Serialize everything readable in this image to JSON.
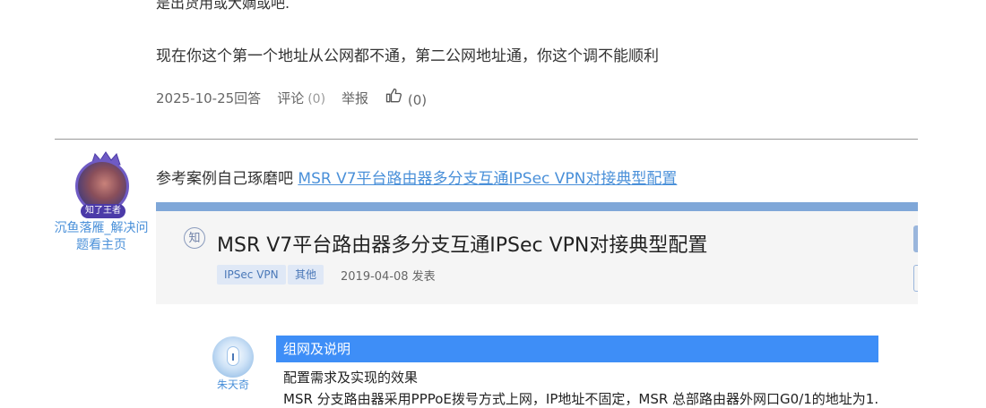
{
  "answer_prev": {
    "cut_text": "是出货用或大嫡或吧.",
    "text": "现在你这个第一个地址从公网都不通，第二公网地址通，你这个调不能顺利",
    "date_label": "2025-10-25回答",
    "comment_label": "评论",
    "comment_count": "(0)",
    "report_label": "举报",
    "like_count": "(0)"
  },
  "answer": {
    "author": {
      "badge": "知了王者",
      "name_link": "沉鱼落雁_解决问题看主页"
    },
    "ref_prefix": "参考案例自己琢磨吧 ",
    "ref_link": "MSR V7平台路由器多分支互通IPSec VPN对接典型配置"
  },
  "card": {
    "icon_char": "知",
    "title": "MSR V7平台路由器多分支互通IPSec VPN对接典型配置",
    "tags": [
      "IPSec VPN",
      "其他"
    ],
    "date": "2019-04-08 发表"
  },
  "doc": {
    "author_name": "朱天奇",
    "section_header": "组网及说明",
    "req_title": "配置需求及实现的效果",
    "req_text": "MSR 分支路由器采用PPPoE拨号方式上网，IP地址不固定，MSR 总部路由器外网口G0/1的地址为1."
  },
  "colors": {
    "link": "#4a90d9",
    "accent_blue": "#3e8ef7"
  }
}
